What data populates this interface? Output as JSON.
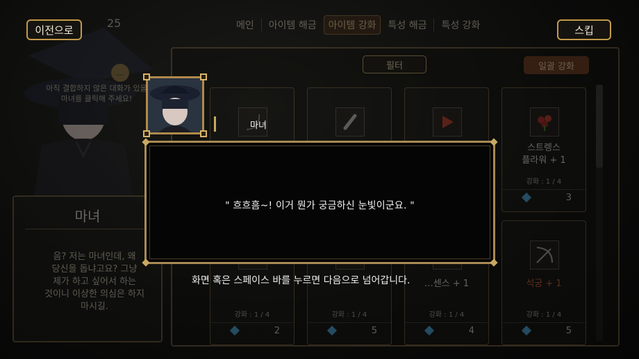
{
  "header": {
    "prev_button": "이전으로",
    "skip_button": "스킵",
    "level": "25",
    "tabs": [
      "메인",
      "아이템 해금",
      "아이템 강화",
      "특성 해금",
      "특성 강화"
    ],
    "active_tab_index": 2
  },
  "toolbar": {
    "filter_button": "필터",
    "bulk_enhance_button": "일괄 강화"
  },
  "hint": {
    "text": "아직 결합하지 않은 대화가 있을\n마녀를 클릭해 주세요!"
  },
  "character_panel": {
    "name": "마녀",
    "description": "음? 저는 마녀인데, 왜\n당신을 돕냐고요? 그냥\n제가 하고 싶어서 하는\n것이니 이상한 의심은 하지\n마시길."
  },
  "cards": [
    {
      "name": "",
      "enhance": "",
      "cost": ""
    },
    {
      "name": "",
      "enhance": "",
      "cost": ""
    },
    {
      "name": "",
      "enhance": "",
      "cost": ""
    },
    {
      "name": "스트렝스\n플라워 + 1",
      "enhance": "강화 : 1 / 4",
      "cost": "3",
      "icon": "flower-icon"
    },
    {
      "name": "",
      "enhance": "강화 : 1 / 4",
      "cost": "2"
    },
    {
      "name": "",
      "enhance": "강화 : 1 / 4",
      "cost": "5"
    },
    {
      "name": "…센스 + 1",
      "enhance": "강화 : 1 / 4",
      "cost": "4"
    },
    {
      "name": "석궁 + 1",
      "enhance": "강화 : 1 / 4",
      "cost": "5",
      "icon": "crossbow-icon",
      "name_color": "#c86040"
    }
  ],
  "dialogue": {
    "speaker": "마녀",
    "text": "\" 흐흐흠~! 이거 뭔가 궁금하신 눈빛이군요. \"",
    "continue_hint": "화면 혹은 스페이스 바를 누르면 다음으로 넘어갑니다."
  },
  "colors": {
    "gold_border": "#a98a52",
    "accent_tab": "#3a2416",
    "bulk_button": "#6e3a20",
    "cost_gem": "#4aa8d8"
  }
}
